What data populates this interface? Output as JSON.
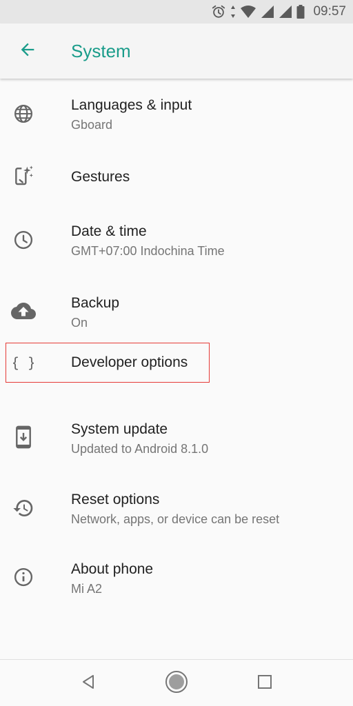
{
  "status_bar": {
    "time": "09:57",
    "icons": [
      "alarm-icon",
      "data-arrows-icon",
      "wifi-icon",
      "signal-icon",
      "signal-icon",
      "battery-icon"
    ]
  },
  "app_bar": {
    "title": "System",
    "back_icon": "arrow-back-icon",
    "accent_color": "#1a9c8a"
  },
  "settings": [
    {
      "title": "Languages & input",
      "subtitle": "Gboard",
      "icon": "globe-icon"
    },
    {
      "title": "Gestures",
      "subtitle": "",
      "icon": "gestures-icon"
    },
    {
      "title": "Date & time",
      "subtitle": "GMT+07:00 Indochina Time",
      "icon": "clock-icon"
    },
    {
      "title": "Backup",
      "subtitle": "On",
      "icon": "cloud-upload-icon"
    },
    {
      "title": "Developer options",
      "subtitle": "",
      "icon": "braces-icon"
    },
    {
      "title": "System update",
      "subtitle": "Updated to Android 8.1.0",
      "icon": "system-update-icon"
    },
    {
      "title": "Reset options",
      "subtitle": "Network, apps, or device can be reset",
      "icon": "restore-icon"
    },
    {
      "title": "About phone",
      "subtitle": "Mi A2",
      "icon": "info-icon"
    }
  ],
  "highlight": {
    "target": "Developer options",
    "color": "#e53935"
  },
  "nav_bar": {
    "buttons": [
      "back-triangle-icon",
      "home-circle-icon",
      "recents-square-icon"
    ]
  }
}
